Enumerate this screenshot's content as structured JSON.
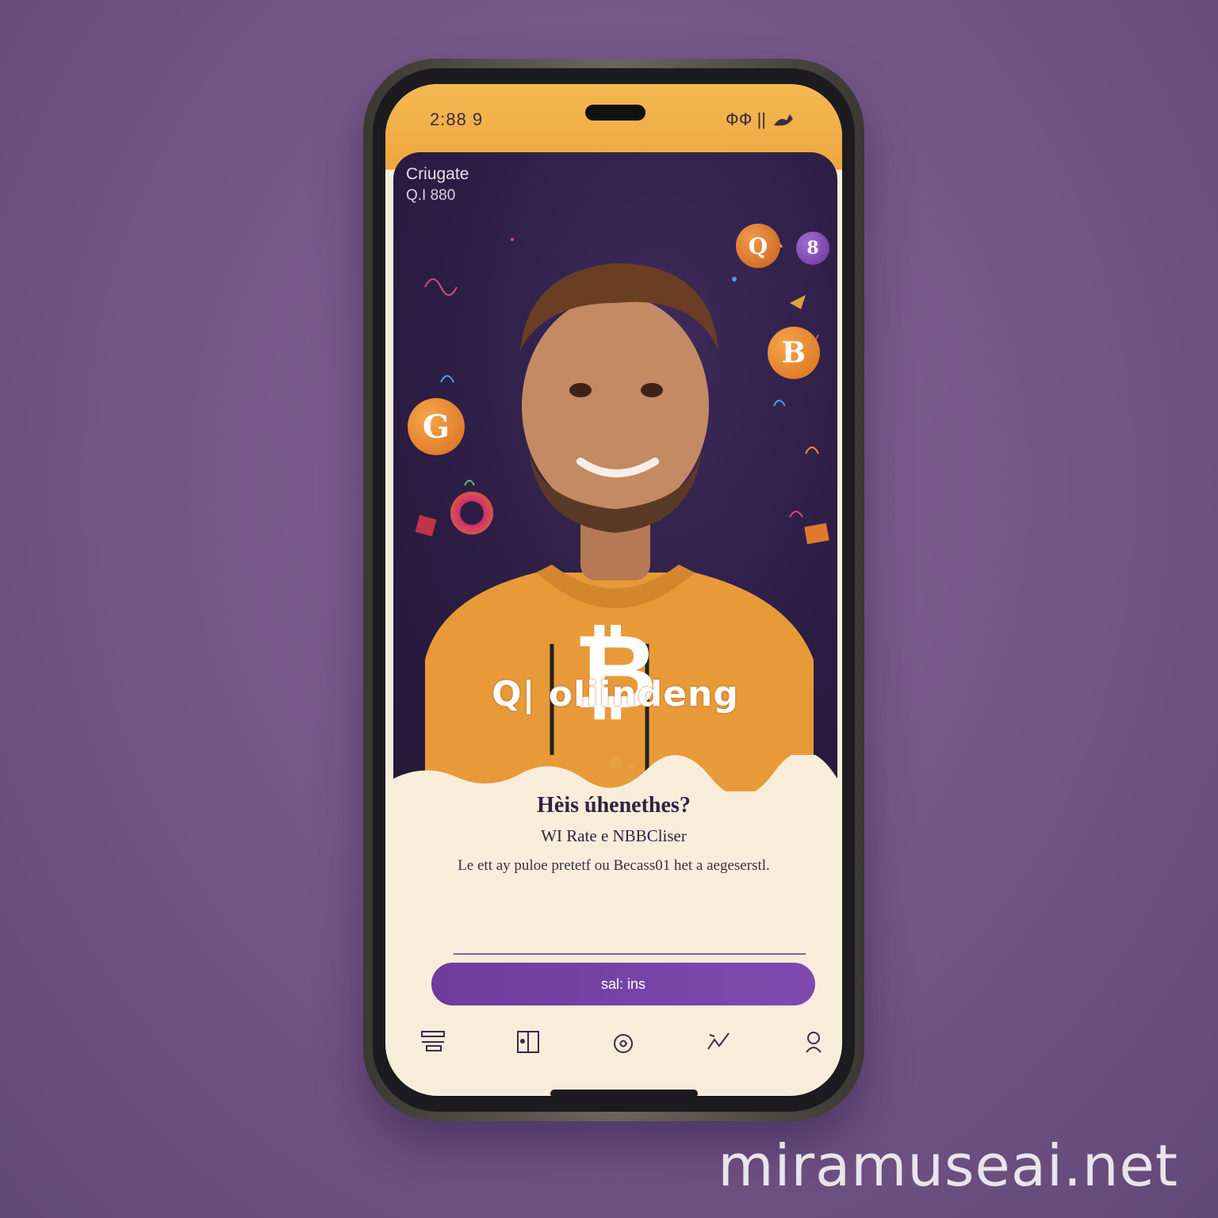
{
  "status_bar": {
    "left_text": "2:88 9",
    "right_text": "ФФ ||"
  },
  "hero": {
    "title": "Criugate",
    "subtitle": "Q.I 880",
    "overlay_text": "Q| oliindeng",
    "coin_labels": [
      "G",
      "B",
      "Q",
      "8"
    ]
  },
  "content": {
    "headline": "Hèis úhenethes?",
    "subheadline": "WI Rate e NBBCliser",
    "description": "Le ett ay puloe pretetf ou Becass01 het a aegeserstl."
  },
  "cta": {
    "label": "sal: ins"
  },
  "tabbar": {
    "items": [
      {
        "icon": "list-icon"
      },
      {
        "icon": "book-icon"
      },
      {
        "icon": "coin-icon"
      },
      {
        "icon": "chart-icon"
      },
      {
        "icon": "profile-icon"
      }
    ]
  },
  "watermark": {
    "text": "miramuseai.net"
  },
  "colors": {
    "background": "#735587",
    "accent_orange": "#efa641",
    "accent_purple": "#7f4aaf",
    "hero_dark": "#2c1d44",
    "panel": "#f8eddb"
  }
}
